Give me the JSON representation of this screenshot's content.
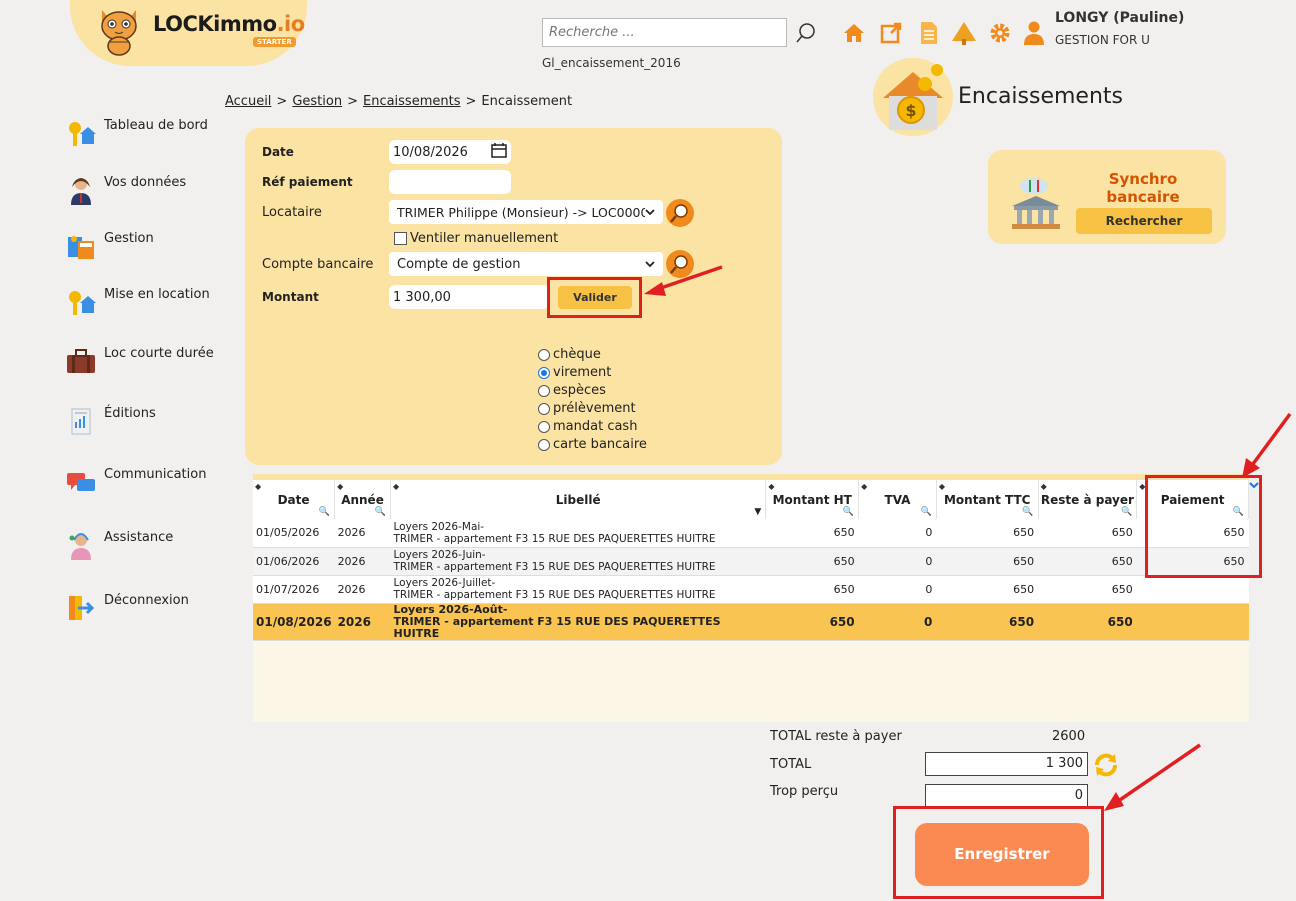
{
  "header": {
    "logo_text": "LOCKimmo",
    "logo_suffix": ".io",
    "logo_badge": "STARTER",
    "search_placeholder": "Recherche ...",
    "file_name": "Gl_encaissement_2016",
    "user_name": "LONGY (Pauline)",
    "user_company": "GESTION FOR U",
    "icons": [
      "home-icon",
      "external-link-icon",
      "document-icon",
      "tree-icon",
      "gear-icon",
      "user-icon"
    ],
    "accent_color": "#f08a1c"
  },
  "breadcrumb": {
    "items": [
      "Accueil",
      "Gestion",
      "Encaissements",
      "Encaissement"
    ],
    "separator": ">"
  },
  "page_title": "Encaissements",
  "sync": {
    "title": "Synchro bancaire",
    "button": "Rechercher"
  },
  "sidebar": {
    "items": [
      {
        "label": "Tableau de bord",
        "icon": "keys-house-icon"
      },
      {
        "label": "Vos données",
        "icon": "person-icon"
      },
      {
        "label": "Gestion",
        "icon": "calculator-icon"
      },
      {
        "label": "Mise en location",
        "icon": "keys-house-icon"
      },
      {
        "label": "Loc courte durée",
        "icon": "suitcase-icon"
      },
      {
        "label": "Éditions",
        "icon": "report-icon"
      },
      {
        "label": "Communication",
        "icon": "chat-icon"
      },
      {
        "label": "Assistance",
        "icon": "support-agent-icon"
      },
      {
        "label": "Déconnexion",
        "icon": "logout-icon"
      }
    ]
  },
  "form": {
    "date_label": "Date",
    "date_value": "10/08/2026",
    "ref_label": "Réf paiement",
    "ref_value": "",
    "locataire_label": "Locataire",
    "locataire_value": "TRIMER Philippe (Monsieur) -> LOC0000",
    "ventiler_label": "Ventiler manuellement",
    "compte_label": "Compte bancaire",
    "compte_value": "Compte de gestion",
    "montant_label": "Montant",
    "montant_value": "1 300,00",
    "valider_label": "Valider",
    "payment_methods": [
      "chèque",
      "virement",
      "espèces",
      "prélèvement",
      "mandat cash",
      "carte bancaire"
    ],
    "selected_method": "virement"
  },
  "table": {
    "columns": [
      "Date",
      "Année",
      "Libellé",
      "Montant HT",
      "TVA",
      "Montant TTC",
      "Reste à payer",
      "Paiement"
    ],
    "rows": [
      {
        "date": "01/05/2026",
        "annee": "2026",
        "lib1": "Loyers 2026-Mai-",
        "lib2": "TRIMER - appartement F3 15 RUE DES PAQUERETTES HUITRE",
        "ht": "650",
        "tva": "0",
        "ttc": "650",
        "reste": "650",
        "paiement": "650"
      },
      {
        "date": "01/06/2026",
        "annee": "2026",
        "lib1": "Loyers 2026-Juin-",
        "lib2": "TRIMER - appartement F3 15 RUE DES PAQUERETTES HUITRE",
        "ht": "650",
        "tva": "0",
        "ttc": "650",
        "reste": "650",
        "paiement": "650"
      },
      {
        "date": "01/07/2026",
        "annee": "2026",
        "lib1": "Loyers 2026-Juillet-",
        "lib2": "TRIMER - appartement F3 15 RUE DES PAQUERETTES HUITRE",
        "ht": "650",
        "tva": "0",
        "ttc": "650",
        "reste": "650",
        "paiement": ""
      },
      {
        "date": "01/08/2026",
        "annee": "2026",
        "lib1": "Loyers 2026-Août-",
        "lib2": "TRIMER - appartement F3 15 RUE DES PAQUERETTES HUITRE",
        "ht": "650",
        "tva": "0",
        "ttc": "650",
        "reste": "650",
        "paiement": ""
      }
    ]
  },
  "totals": {
    "reste_label": "TOTAL reste à payer",
    "reste_value": "2600",
    "total_label": "TOTAL",
    "total_value": "1 300",
    "trop_label": "Trop perçu",
    "trop_value": "0"
  },
  "save_label": "Enregistrer",
  "annotation_color": "#e02020"
}
